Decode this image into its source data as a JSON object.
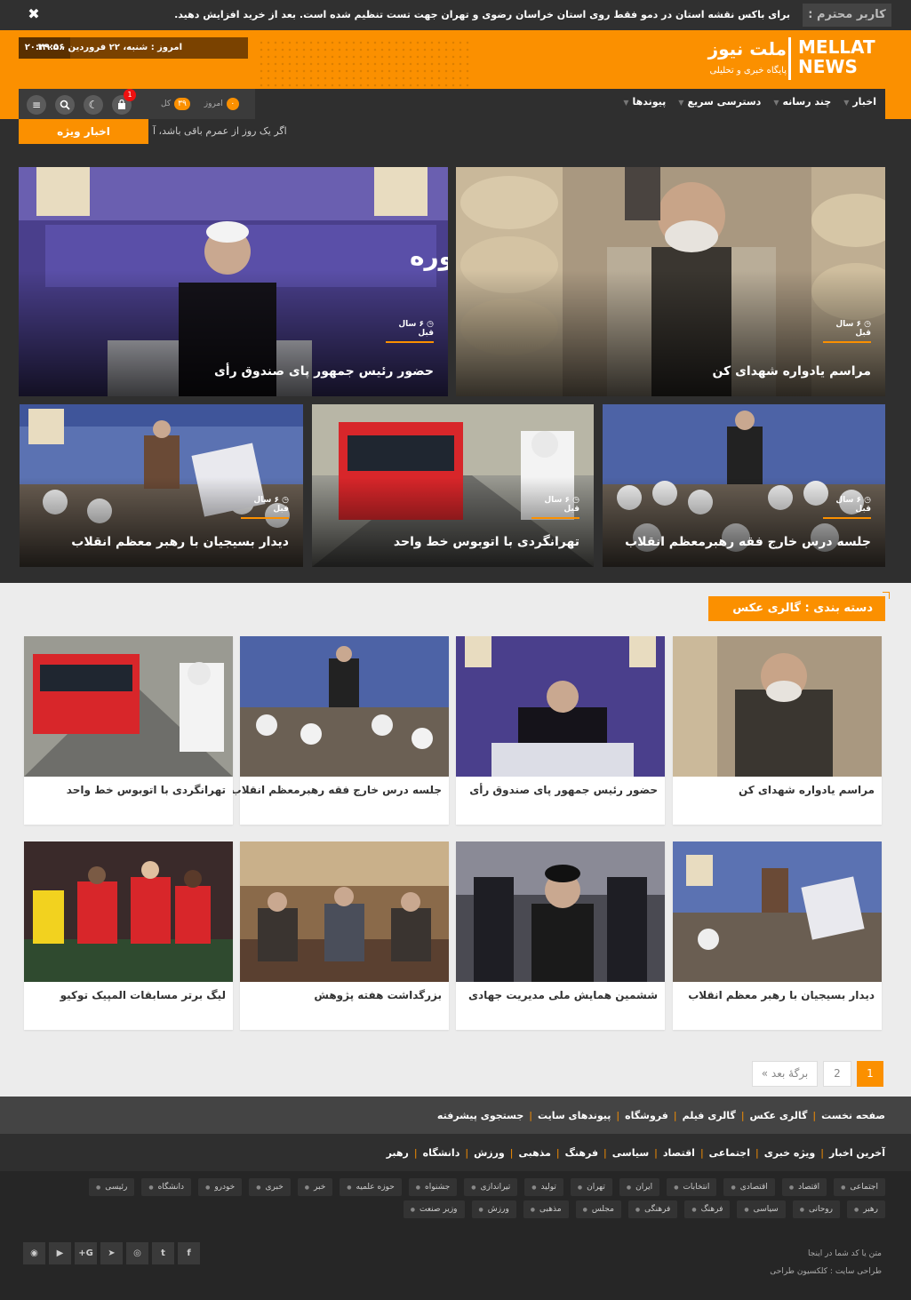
{
  "notice": {
    "badge": "کاربر محترم :",
    "message": "برای باکس نقشه استان در دمو فقط روی استان خراسان رضوی و تهران جهت تست تنظیم شده است. بعد از خرید افزایش دهید.",
    "close": "✖"
  },
  "header": {
    "logo_en_1": "MELLAT",
    "logo_en_2": "NEWS",
    "logo_fa": "ملت نیوز",
    "logo_sub": "پایگاه خبری و تحلیلی",
    "clock": "۲۰:۴۹:۵۶",
    "today": "امروز : شنبه، ۲۲ فروردین ، ۱۴۰۵"
  },
  "nav": {
    "items": [
      "اخبار",
      "چند رسانه",
      "دسترسی سریع",
      "پیوندها"
    ],
    "stats_total_label": "کل",
    "stats_total": "۳۹",
    "stats_today_label": "امروز",
    "stats_today": "۰",
    "cart_count": "1"
  },
  "breaking": {
    "tag": "اخبار ویژه",
    "ticker": "اگر یک روز از عمرم باقی باشد، آ"
  },
  "hero": {
    "time": "۶ سال قبل",
    "items": [
      {
        "title": "مراسم یادواره شهدای کن"
      },
      {
        "title": "حضور رئیس جمهور پای صندوق رأی"
      },
      {
        "title": "جلسه درس خارج فقه رهبرمعظم انقلاب"
      },
      {
        "title": "تهرانگردی با اتوبوس خط واحد"
      },
      {
        "title": "دیدار بسیجیان با رهبر معظم انقلاب"
      }
    ]
  },
  "gallery": {
    "heading": "دسته بندی :     گالری عکس",
    "items": [
      {
        "title": "مراسم یادواره شهدای کن"
      },
      {
        "title": "حضور رئیس جمهور پای صندوق رأی"
      },
      {
        "title": "جلسه درس خارج فقه رهبرمعظم انقلاب"
      },
      {
        "title": "تهرانگردی با اتوبوس خط واحد"
      },
      {
        "title": "دیدار بسیجیان با رهبر معظم انقلاب"
      },
      {
        "title": "ششمین همایش ملی مدیریت جهادی"
      },
      {
        "title": "بزرگداشت هفته پژوهش"
      },
      {
        "title": "لیگ برتر مسابقات المپیک توکیو"
      }
    ]
  },
  "pagination": {
    "page1": "1",
    "page2": "2",
    "next": "برگهٔ بعد »"
  },
  "footer": {
    "row1": [
      "صفحه نخست",
      "گالری عکس",
      "گالری فیلم",
      "فروشگاه",
      "پیوندهای سایت",
      "جستجوی پیشرفته"
    ],
    "row2": [
      "آخرین اخبار",
      "ویژه خبری",
      "اجتماعی",
      "اقتصاد",
      "سیاسی",
      "فرهنگ",
      "مذهبی",
      "ورزش",
      "دانشگاه",
      "رهبر"
    ],
    "tags": [
      "اجتماعی",
      "اقتصاد",
      "اقتصادی",
      "انتخابات",
      "ایران",
      "تهران",
      "تولید",
      "تیراندازی",
      "جشنواه",
      "حوزه علمیه",
      "خبر",
      "خبری",
      "خودرو",
      "دانشگاه",
      "رئیسی",
      "رهبر",
      "روحانی",
      "سیاسی",
      "فرهنگ",
      "فرهنگی",
      "مجلس",
      "مذهبی",
      "ورزش",
      "وزیر صنعت"
    ],
    "social": [
      "f-icon",
      "twitter-icon",
      "instagram-icon",
      "telegram-icon",
      "googleplus-icon",
      "youtube-icon",
      "rss-icon"
    ],
    "copy1": "متن یا کد شما در اینجا",
    "copy2": "طراحی سایت : کلکسیون طراحی"
  },
  "colors": {
    "accent": "#fb9000",
    "dark": "#2f2f2f"
  }
}
